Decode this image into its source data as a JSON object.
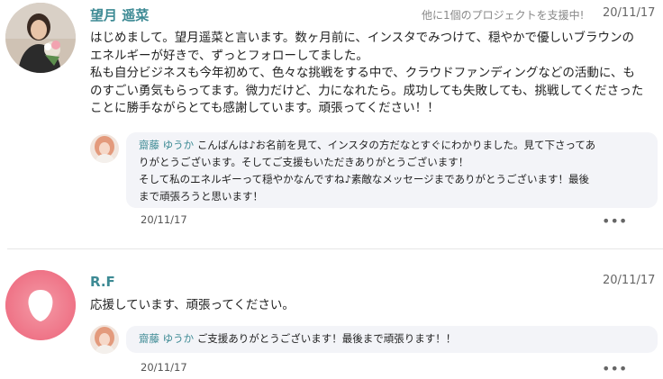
{
  "comments": [
    {
      "author": "望月 遥菜",
      "meta_note": "他に1個のプロジェクトを支援中!",
      "date": "20/11/17",
      "avatar_icon": "user-photo-avatar",
      "body_lines": [
        "はじめまして。望月遥菜と言います。数ヶ月前に、インスタでみつけて、穏やかで優しいブラウンの",
        "エネルギーが好きで、ずっとフォローしてました。",
        "私も自分ビジネスも今年初めて、色々な挑戦をする中で、クラウドファンディングなどの活動に、も",
        "のすごい勇気もらってます。微力だけど、力になれたら。成功しても失敗しても、挑戦してくださった",
        "ことに勝手ながらとても感謝しています。頑張ってください！！"
      ],
      "reply": {
        "author": "齋藤 ゆうか",
        "lines": [
          "こんばんは♪お名前を見て、インスタの方だなとすぐにわかりました。見て下さってあ",
          "りがとうございます。そしてご支援もいただきありがとうございます！",
          "そして私のエネルギーって穏やかなんですね♪素敵なメッセージまでありがとうございます！最後",
          "まで頑張ろうと思います！"
        ],
        "date": "20/11/17",
        "more_icon": "more-horizontal-icon"
      }
    },
    {
      "author": "R.F",
      "date": "20/11/17",
      "avatar_icon": "default-avatar-icon",
      "body_lines": [
        "応援しています、頑張ってください。"
      ],
      "reply": {
        "author": "齋藤 ゆうか",
        "lines": [
          "ご支援ありがとうございます！最後まで頑張ります！！"
        ],
        "date": "20/11/17",
        "more_icon": "more-horizontal-icon"
      }
    }
  ],
  "colors": {
    "name_accent": "#3d8a94",
    "bubble_bg": "#f3f4f8",
    "default_avatar": "#f27a8a"
  }
}
